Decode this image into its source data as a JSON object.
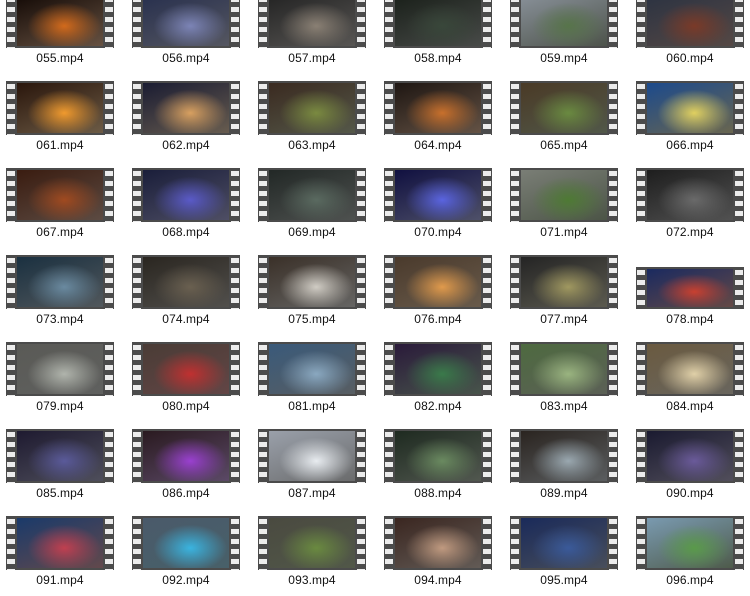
{
  "window": {
    "view": "large-icons"
  },
  "files": [
    {
      "name": "055.mp4",
      "thumb": {
        "bg": "#140a06",
        "hl": "#d26a1c",
        "tone": "campfire"
      }
    },
    {
      "name": "056.mp4",
      "thumb": {
        "bg": "#28304e",
        "hl": "#7c84b6",
        "tone": "night-sky-forest"
      }
    },
    {
      "name": "057.mp4",
      "thumb": {
        "bg": "#242424",
        "hl": "#8a8074",
        "tone": "dark-bedroom"
      }
    },
    {
      "name": "058.mp4",
      "thumb": {
        "bg": "#1a201a",
        "hl": "#39473a",
        "tone": "dark-forest"
      }
    },
    {
      "name": "059.mp4",
      "thumb": {
        "bg": "#889098",
        "hl": "#57744a",
        "tone": "mountain-meadow"
      }
    },
    {
      "name": "060.mp4",
      "thumb": {
        "bg": "#2c3342",
        "hl": "#7a3a28",
        "tone": "balcony-rain"
      }
    },
    {
      "name": "061.mp4",
      "thumb": {
        "bg": "#2a160c",
        "hl": "#f09a2e",
        "tone": "tent-fire"
      }
    },
    {
      "name": "062.mp4",
      "thumb": {
        "bg": "#1a1c32",
        "hl": "#d8a060",
        "tone": "night-house"
      }
    },
    {
      "name": "063.mp4",
      "thumb": {
        "bg": "#3a2a20",
        "hl": "#7a8a40",
        "tone": "cozy-room"
      }
    },
    {
      "name": "064.mp4",
      "thumb": {
        "bg": "#1e1612",
        "hl": "#c8702c",
        "tone": "library-fireplace"
      }
    },
    {
      "name": "065.mp4",
      "thumb": {
        "bg": "#4a3a26",
        "hl": "#6a8a40",
        "tone": "garden-fireplace"
      }
    },
    {
      "name": "066.mp4",
      "thumb": {
        "bg": "#1c4a8c",
        "hl": "#e0d060",
        "tone": "anime-art"
      }
    },
    {
      "name": "067.mp4",
      "thumb": {
        "bg": "#3a1c10",
        "hl": "#a04a20",
        "tone": "library-room"
      }
    },
    {
      "name": "068.mp4",
      "thumb": {
        "bg": "#1a1e3a",
        "hl": "#5a5ac8",
        "tone": "night-car"
      }
    },
    {
      "name": "069.mp4",
      "thumb": {
        "bg": "#222826",
        "hl": "#5a6a60",
        "tone": "window-room"
      }
    },
    {
      "name": "070.mp4",
      "thumb": {
        "bg": "#101040",
        "hl": "#5a64e0",
        "tone": "neon-city"
      }
    },
    {
      "name": "071.mp4",
      "thumb": {
        "bg": "#7a7e76",
        "hl": "#4e7a34",
        "tone": "wet-road"
      }
    },
    {
      "name": "072.mp4",
      "thumb": {
        "bg": "#1e1e1e",
        "hl": "#6a6a6a",
        "tone": "dark-room"
      }
    },
    {
      "name": "073.mp4",
      "thumb": {
        "bg": "#1a3040",
        "hl": "#6a8aa0",
        "tone": "milky-way"
      }
    },
    {
      "name": "074.mp4",
      "thumb": {
        "bg": "#2a2620",
        "hl": "#6a6050",
        "tone": "dim-room"
      }
    },
    {
      "name": "075.mp4",
      "thumb": {
        "bg": "#3a3028",
        "hl": "#d0ccc4",
        "tone": "bedroom-bed"
      }
    },
    {
      "name": "076.mp4",
      "thumb": {
        "bg": "#4a3a2c",
        "hl": "#e09a4c",
        "tone": "lodge-fireplace"
      }
    },
    {
      "name": "077.mp4",
      "thumb": {
        "bg": "#242424",
        "hl": "#a09860",
        "tone": "storm-clouds"
      }
    },
    {
      "name": "078.mp4",
      "thumb": {
        "bg": "#1a2a60",
        "hl": "#c84030",
        "tone": "blue-interior"
      }
    },
    {
      "name": "079.mp4",
      "thumb": {
        "bg": "#5a5a56",
        "hl": "#b0b4ac",
        "tone": "sunroom"
      }
    },
    {
      "name": "080.mp4",
      "thumb": {
        "bg": "#4a3c36",
        "hl": "#c03030",
        "tone": "flowers-balcony"
      }
    },
    {
      "name": "081.mp4",
      "thumb": {
        "bg": "#3a5a7a",
        "hl": "#8aa8c0",
        "tone": "tree-sky"
      }
    },
    {
      "name": "082.mp4",
      "thumb": {
        "bg": "#2a1a3a",
        "hl": "#3a7a4a",
        "tone": "window-garden"
      }
    },
    {
      "name": "083.mp4",
      "thumb": {
        "bg": "#4e6a40",
        "hl": "#9ab480",
        "tone": "park-bench"
      }
    },
    {
      "name": "084.mp4",
      "thumb": {
        "bg": "#6a5a40",
        "hl": "#e0d0a8",
        "tone": "golden-field"
      }
    },
    {
      "name": "085.mp4",
      "thumb": {
        "bg": "#1e1a30",
        "hl": "#5a5a9a",
        "tone": "night-window"
      }
    },
    {
      "name": "086.mp4",
      "thumb": {
        "bg": "#2a1a20",
        "hl": "#9a40d0",
        "tone": "city-desk"
      }
    },
    {
      "name": "087.mp4",
      "thumb": {
        "bg": "#9aa0aa",
        "hl": "#e8ecf0",
        "tone": "snow-forest"
      }
    },
    {
      "name": "088.mp4",
      "thumb": {
        "bg": "#1e2a20",
        "hl": "#6a8a60",
        "tone": "green-bedroom"
      }
    },
    {
      "name": "089.mp4",
      "thumb": {
        "bg": "#2a2420",
        "hl": "#9aa8b0",
        "tone": "attic-bed"
      }
    },
    {
      "name": "090.mp4",
      "thumb": {
        "bg": "#1a1a30",
        "hl": "#6a5a9a",
        "tone": "night-interior"
      }
    },
    {
      "name": "091.mp4",
      "thumb": {
        "bg": "#1a3a6a",
        "hl": "#c04050",
        "tone": "cyber-street"
      }
    },
    {
      "name": "092.mp4",
      "thumb": {
        "bg": "#4a5a6a",
        "hl": "#3ab4e0",
        "tone": "aquarium-room"
      }
    },
    {
      "name": "093.mp4",
      "thumb": {
        "bg": "#4a4a40",
        "hl": "#6a8a40",
        "tone": "waterfall"
      }
    },
    {
      "name": "094.mp4",
      "thumb": {
        "bg": "#3a2620",
        "hl": "#c09a80",
        "tone": "warm-bedroom"
      }
    },
    {
      "name": "095.mp4",
      "thumb": {
        "bg": "#1a2a5a",
        "hl": "#3a5a9a",
        "tone": "blue-night"
      }
    },
    {
      "name": "096.mp4",
      "thumb": {
        "bg": "#7a9ab0",
        "hl": "#5a9a4a",
        "tone": "rain-grass"
      }
    }
  ]
}
